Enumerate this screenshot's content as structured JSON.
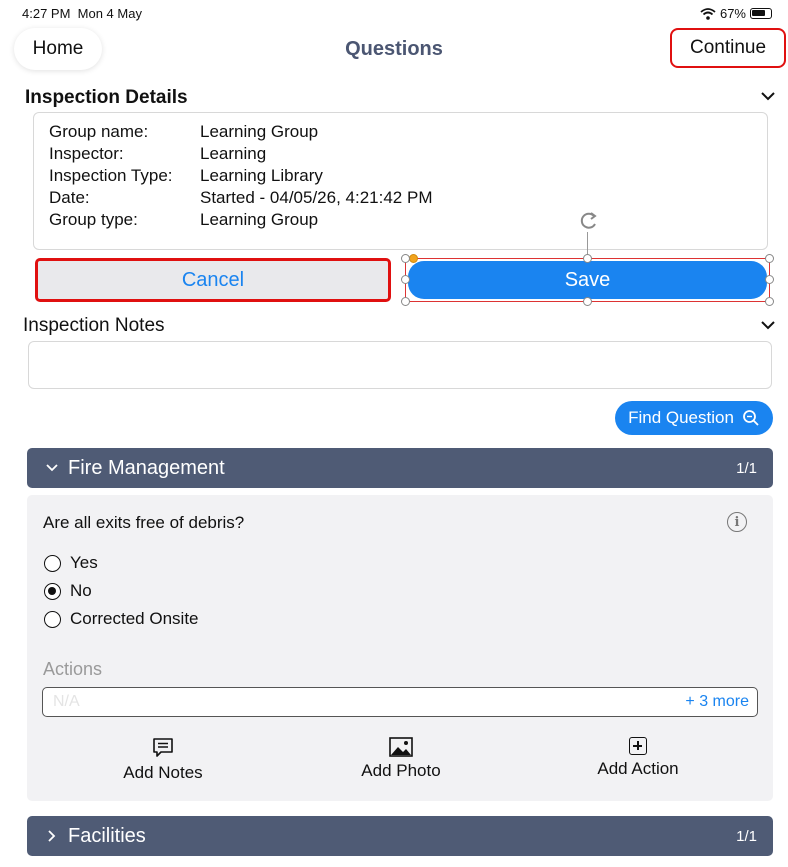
{
  "status": {
    "time": "4:27 PM",
    "date": "Mon 4 May",
    "battery": "67%"
  },
  "nav": {
    "home": "Home",
    "title": "Questions",
    "continue": "Continue"
  },
  "inspection_details": {
    "heading": "Inspection Details",
    "rows": [
      {
        "label": "Group name:",
        "value": "Learning Group"
      },
      {
        "label": "Inspector:",
        "value": "Learning"
      },
      {
        "label": "Inspection Type:",
        "value": "Learning Library"
      },
      {
        "label": "Date:",
        "value": "Started - 04/05/26, 4:21:42 PM"
      },
      {
        "label": "Group type:",
        "value": "Learning Group"
      }
    ]
  },
  "buttons": {
    "cancel": "Cancel",
    "save": "Save",
    "find_question": "Find Question"
  },
  "inspection_notes": {
    "heading": "Inspection Notes",
    "value": ""
  },
  "categories": [
    {
      "name": "Fire Management",
      "count": "1/1",
      "expanded": true
    },
    {
      "name": "Facilities",
      "count": "1/1",
      "expanded": false
    }
  ],
  "question": {
    "text": "Are all exits free of debris?",
    "options": [
      {
        "label": "Yes",
        "selected": false
      },
      {
        "label": "No",
        "selected": true
      },
      {
        "label": "Corrected Onsite",
        "selected": false
      }
    ],
    "actions_label": "Actions",
    "actions_placeholder": "N/A",
    "actions_more": "+ 3 more",
    "add_notes": "Add Notes",
    "add_photo": "Add Photo",
    "add_action": "Add Action"
  },
  "colors": {
    "accent": "#1a84f0",
    "category_bar": "#4f5b75",
    "highlight": "#e01010"
  }
}
